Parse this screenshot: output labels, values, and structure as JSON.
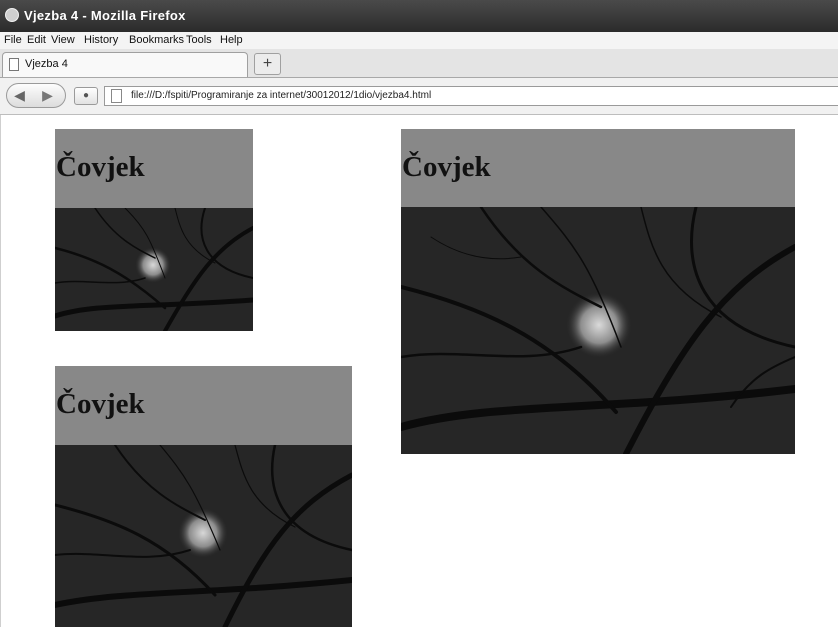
{
  "window": {
    "title": "Vjezba 4 - Mozilla Firefox"
  },
  "menu": [
    "File",
    "Edit",
    "View",
    "History",
    "Bookmarks",
    "Tools",
    "Help"
  ],
  "tab": {
    "label": "Vjezba 4",
    "new_tab": "+"
  },
  "nav": {
    "url": "file:///D:/fspiti/Programiranje za internet/30012012/1dio/vjezba4.html"
  },
  "cards": [
    {
      "heading": "Čovjek"
    },
    {
      "heading": "Čovjek"
    },
    {
      "heading": "Čovjek"
    }
  ]
}
